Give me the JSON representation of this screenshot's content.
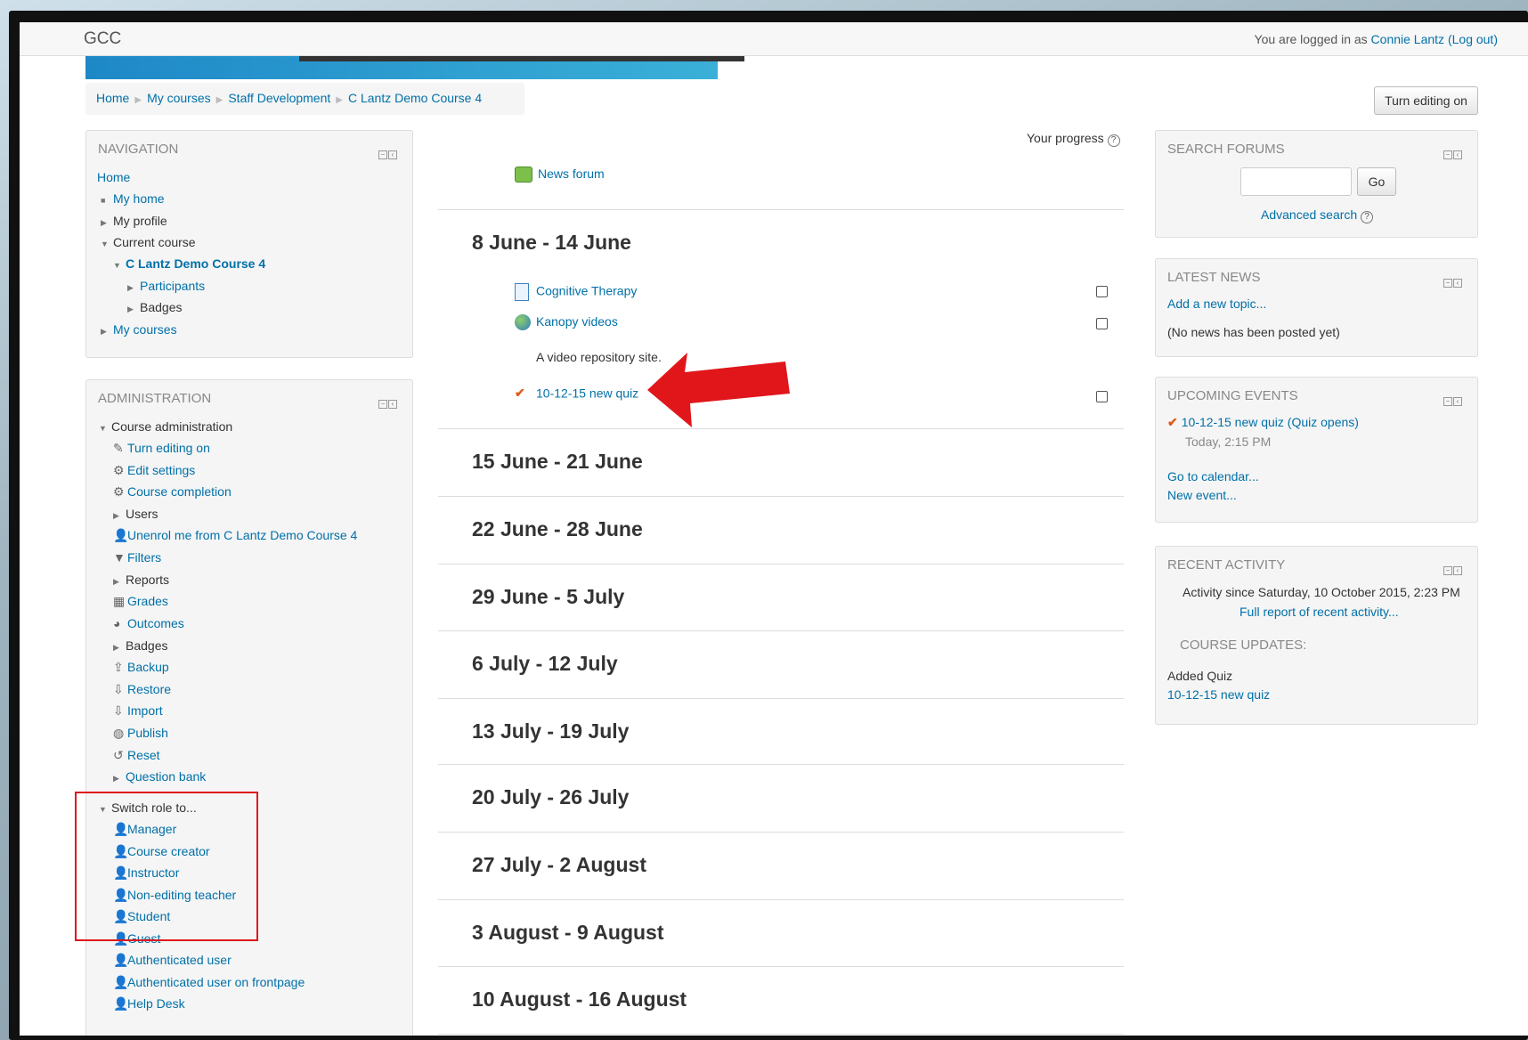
{
  "topbar": {
    "site_name": "GCC",
    "login_prefix": "You are logged in as ",
    "user_name": "Connie Lantz",
    "logout": "(Log out)"
  },
  "breadcrumb": [
    "Home",
    "My courses",
    "Staff Development",
    "C Lantz Demo Course 4"
  ],
  "turn_editing_button": "Turn editing on",
  "navigation": {
    "header": "NAVIGATION",
    "home": "Home",
    "my_home": "My home",
    "my_profile": "My profile",
    "current_course": "Current course",
    "course_name": "C Lantz Demo Course 4",
    "participants": "Participants",
    "badges": "Badges",
    "my_courses": "My courses"
  },
  "administration": {
    "header": "ADMINISTRATION",
    "course_admin": "Course administration",
    "items": [
      "Turn editing on",
      "Edit settings",
      "Course completion",
      "Users",
      "Unenrol me from C Lantz Demo Course 4",
      "Filters",
      "Reports",
      "Grades",
      "Outcomes",
      "Badges",
      "Backup",
      "Restore",
      "Import",
      "Publish",
      "Reset",
      "Question bank"
    ],
    "switch_role": "Switch role to...",
    "roles": [
      "Manager",
      "Course creator",
      "Instructor",
      "Non-editing teacher",
      "Student",
      "Guest",
      "Authenticated user",
      "Authenticated user on frontpage",
      "Help Desk"
    ]
  },
  "progress_label": "Your progress",
  "news_forum": "News forum",
  "sections": [
    {
      "title": "8 June - 14 June"
    },
    {
      "title": "15 June - 21 June"
    },
    {
      "title": "22 June - 28 June"
    },
    {
      "title": "29 June - 5 July"
    },
    {
      "title": "6 July - 12 July"
    },
    {
      "title": "13 July - 19 July"
    },
    {
      "title": "20 July - 26 July"
    },
    {
      "title": "27 July - 2 August"
    },
    {
      "title": "3 August - 9 August"
    },
    {
      "title": "10 August - 16 August"
    }
  ],
  "activities": {
    "cognitive": "Cognitive Therapy",
    "kanopy": "Kanopy videos",
    "kanopy_desc": "A video repository site.",
    "quiz": "10-12-15 new quiz"
  },
  "search_forums": {
    "header": "SEARCH FORUMS",
    "go": "Go",
    "advanced": "Advanced search"
  },
  "latest_news": {
    "header": "LATEST NEWS",
    "add_topic": "Add a new topic...",
    "empty": "(No news has been posted yet)"
  },
  "upcoming_events": {
    "header": "UPCOMING EVENTS",
    "event": "10-12-15 new quiz (Quiz opens)",
    "event_time": "Today, 2:15 PM",
    "go_calendar": "Go to calendar...",
    "new_event": "New event..."
  },
  "recent_activity": {
    "header": "RECENT ACTIVITY",
    "since": "Activity since Saturday, 10 October 2015, 2:23 PM",
    "full_report": "Full report of recent activity...",
    "updates_header": "COURSE UPDATES:",
    "added": "Added Quiz",
    "quiz_link": "10-12-15 new quiz"
  },
  "colors": {
    "link": "#0070a8",
    "annotation_red": "#e0161b"
  }
}
